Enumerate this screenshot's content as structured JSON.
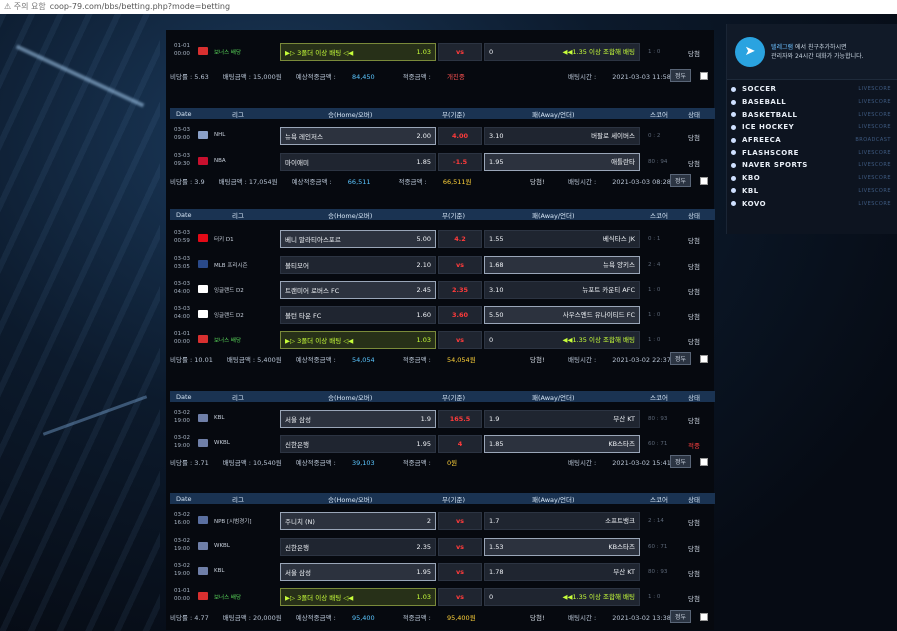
{
  "address_bar": {
    "warning": "⚠ 주의 요함",
    "url": "coop-79.com/bbs/betting.php?mode=betting"
  },
  "sidebar": {
    "telegram_text_1": "텔레그램",
    "telegram_text_2": "에서 친구추가하시면",
    "telegram_text_3": "관리자와 24시간 대화가 가능합니다.",
    "links": [
      {
        "label": "SOCCER",
        "sub": "LIVESCORE"
      },
      {
        "label": "BASEBALL",
        "sub": "LIVESCORE"
      },
      {
        "label": "BASKETBALL",
        "sub": "LIVESCORE"
      },
      {
        "label": "ICE HOCKEY",
        "sub": "LIVESCORE"
      },
      {
        "label": "AFREECA",
        "sub": "BROADCAST"
      },
      {
        "label": "FLASHSCORE",
        "sub": "LIVESCORE"
      },
      {
        "label": "NAVER SPORTS",
        "sub": "LIVESCORE"
      },
      {
        "label": "KBO",
        "sub": "LIVESCORE"
      },
      {
        "label": "KBL",
        "sub": "LIVESCORE"
      },
      {
        "label": "KOVO",
        "sub": "LIVESCORE"
      }
    ]
  },
  "header_labels": {
    "date": "Date",
    "league": "리그",
    "home": "승(Home/오버)",
    "draw": "무(기준)",
    "away": "패(Away/언더)",
    "score": "스코어",
    "status": "상태"
  },
  "bet_button": "정두",
  "slips": [
    {
      "rows": [
        {
          "date": "01-01",
          "time": "00:00",
          "league": "보너스 배당",
          "home": "▶▷ 3폴더 이상 배팅 ◁◀",
          "home_odds": "1.03",
          "mid": "vs",
          "away_odds": "0",
          "away": "◀◀1.35 이상 조합해 배팅",
          "score": "1 : 0",
          "status": "당첨"
        }
      ],
      "summary": {
        "odds_label": "비당률 : 5.63",
        "bet_label": "배팅금액 : 15,000원",
        "exp_label": "예상적중금액 :",
        "exp_val": "84,450",
        "hit_label": "적중금액 :",
        "hit_val": "개진중",
        "time_label": "배팅시간 :",
        "time": "2021-03-03 11:58"
      }
    },
    {
      "rows": [
        {
          "date": "03-03",
          "time": "09:00",
          "league": "NHL",
          "home": "뉴욕 레인저스",
          "home_odds": "2.00",
          "mid": "4.00",
          "away_odds": "3.10",
          "away": "버팔로 세이버스",
          "score": "0 : 2",
          "status": "당첨"
        },
        {
          "date": "03-03",
          "time": "09:30",
          "league": "NBA",
          "home": "마이애미",
          "home_odds": "1.85",
          "mid": "-1.5",
          "away_odds": "1.95",
          "away": "애틀란타",
          "score": "80 : 94",
          "status": "당첨"
        }
      ],
      "summary": {
        "odds_label": "비당률 : 3.9",
        "bet_label": "배팅금액 : 17,054원",
        "exp_label": "예상적중금액 :",
        "exp_val": "66,511",
        "hit_label": "적중금액 :",
        "hit_val": "66,511원",
        "time_label": "배팅시간 :",
        "time": "2021-03-03 08:28",
        "won": "당첨!"
      }
    },
    {
      "rows": [
        {
          "date": "03-03",
          "time": "00:59",
          "league": "터키 D1",
          "home": "베니 말라티아스포르",
          "home_odds": "5.00",
          "mid": "4.2",
          "away_odds": "1.55",
          "away": "베식타스 JK",
          "score": "0 : 1",
          "status": "당첨"
        },
        {
          "date": "03-03",
          "time": "03:05",
          "league": "MLB 프리시즌",
          "home": "볼티모어",
          "home_odds": "2.10",
          "mid": "vs",
          "away_odds": "1.68",
          "away": "뉴욕 양키스",
          "score": "2 : 4",
          "status": "당첨"
        },
        {
          "date": "03-03",
          "time": "04:00",
          "league": "잉글랜드 D2",
          "home": "트랜미어 로버스 FC",
          "home_odds": "2.45",
          "mid": "2.35",
          "away_odds": "3.10",
          "away": "뉴포트 카운티 AFC",
          "score": "1 : 0",
          "status": "당첨"
        },
        {
          "date": "03-03",
          "time": "04:00",
          "league": "잉글랜드 D2",
          "home": "볼턴 타운 FC",
          "home_odds": "1.60",
          "mid": "3.60",
          "away_odds": "5.50",
          "away": "사우스엔드 유나이티드 FC",
          "score": "1 : 0",
          "status": "당첨"
        },
        {
          "date": "01-01",
          "time": "00:00",
          "league": "보너스 배당",
          "home": "▶▷ 3폴더 이상 배팅 ◁◀",
          "home_odds": "1.03",
          "mid": "vs",
          "away_odds": "0",
          "away": "◀◀1.35 이상 조합해 배팅",
          "score": "1 : 0",
          "status": "당첨"
        }
      ],
      "summary": {
        "odds_label": "비당률 : 10.01",
        "bet_label": "배팅금액 : 5,400원",
        "exp_label": "예상적중금액 :",
        "exp_val": "54,054",
        "hit_label": "적중금액 :",
        "hit_val": "54,054원",
        "time_label": "배팅시간 :",
        "time": "2021-03-02 22:37",
        "won": "당첨!"
      }
    },
    {
      "rows": [
        {
          "date": "03-02",
          "time": "19:00",
          "league": "KBL",
          "home": "서울 삼성",
          "home_odds": "1.9",
          "mid": "165.5",
          "away_odds": "1.9",
          "away": "부산 KT",
          "score": "80 : 93",
          "status": "당첨"
        },
        {
          "date": "03-02",
          "time": "19:00",
          "league": "WKBL",
          "home": "신한은행",
          "home_odds": "1.95",
          "mid": "4",
          "away_odds": "1.85",
          "away": "KB스타즈",
          "score": "60 : 71",
          "status": "적중"
        }
      ],
      "summary": {
        "odds_label": "비당률 : 3.71",
        "bet_label": "배팅금액 : 10,540원",
        "exp_label": "예상적중금액 :",
        "exp_val": "39,103",
        "hit_label": "적중금액 :",
        "hit_val": "0원",
        "time_label": "배팅시간 :",
        "time": "2021-03-02 15:41"
      }
    },
    {
      "rows": [
        {
          "date": "03-02",
          "time": "16:00",
          "league": "NPB [시범경기]",
          "home": "주니치 (N)",
          "home_odds": "2",
          "mid": "vs",
          "away_odds": "1.7",
          "away": "소프트뱅크",
          "score": "2 : 14",
          "status": "당첨"
        },
        {
          "date": "03-02",
          "time": "19:00",
          "league": "WKBL",
          "home": "신한은행",
          "home_odds": "2.35",
          "mid": "vs",
          "away_odds": "1.53",
          "away": "KB스타즈",
          "score": "60 : 71",
          "status": "당첨"
        },
        {
          "date": "03-02",
          "time": "19:00",
          "league": "KBL",
          "home": "서울 삼성",
          "home_odds": "1.95",
          "mid": "vs",
          "away_odds": "1.78",
          "away": "부산 KT",
          "score": "80 : 93",
          "status": "당첨"
        },
        {
          "date": "01-01",
          "time": "00:00",
          "league": "보너스 배당",
          "home": "▶▷ 3폴더 이상 배팅 ◁◀",
          "home_odds": "1.03",
          "mid": "vs",
          "away_odds": "0",
          "away": "◀◀1.35 이상 조합해 배팅",
          "score": "1 : 0",
          "status": "당첨"
        }
      ],
      "summary": {
        "odds_label": "비당률 : 4.77",
        "bet_label": "배팅금액 : 20,000원",
        "exp_label": "예상적중금액 :",
        "exp_val": "95,400",
        "hit_label": "적중금액 :",
        "hit_val": "95,400원",
        "time_label": "배팅시간 :",
        "time": "2021-03-02 13:38",
        "won": "당첨!"
      }
    }
  ]
}
